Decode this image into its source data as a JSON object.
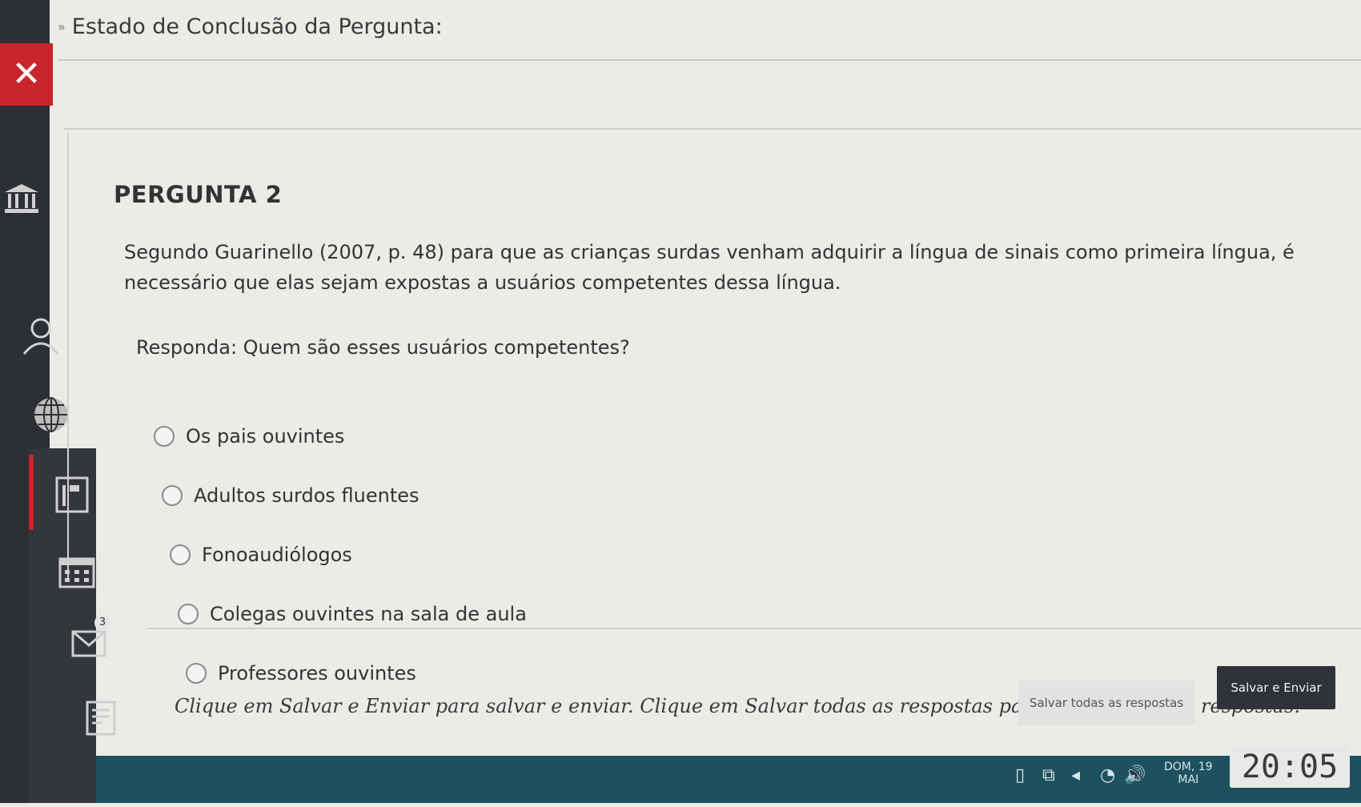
{
  "status": {
    "chevron": "»",
    "title": "Estado de Conclusão da Pergunta:"
  },
  "sidebar": {
    "close": "✕",
    "icons": [
      "institution-icon",
      "user-icon",
      "globe-icon",
      "content-icon",
      "calendar-icon",
      "messages-icon",
      "notes-icon",
      "edit-icon"
    ],
    "badge_count": "3"
  },
  "question": {
    "title": "PERGUNTA 2",
    "text": "Segundo Guarinello (2007, p. 48) para que as crianças surdas venham adquirir a língua de sinais como primeira língua, é necessário que elas sejam expostas a usuários competentes dessa língua.",
    "prompt": "Responda: Quem são esses usuários competentes?",
    "options": [
      "Os pais ouvintes",
      "Adultos surdos fluentes",
      "Fonoaudiólogos",
      "Colegas ouvintes na sala de aula",
      "Professores ouvintes"
    ]
  },
  "footer": {
    "note": "Clique em Salvar e Enviar para salvar e enviar. Clique em Salvar todas as respostas para salvar todas as respostas.",
    "save_all_label": "Salvar todas as respostas",
    "submit_label": "Salvar e Enviar"
  },
  "taskbar": {
    "date_line1": "DOM, 19",
    "date_line2": "MAI",
    "time": "20:05"
  },
  "colors": {
    "accent_red": "#c8252d",
    "rail": "#2c2f33",
    "taskbar": "#1d5160"
  }
}
